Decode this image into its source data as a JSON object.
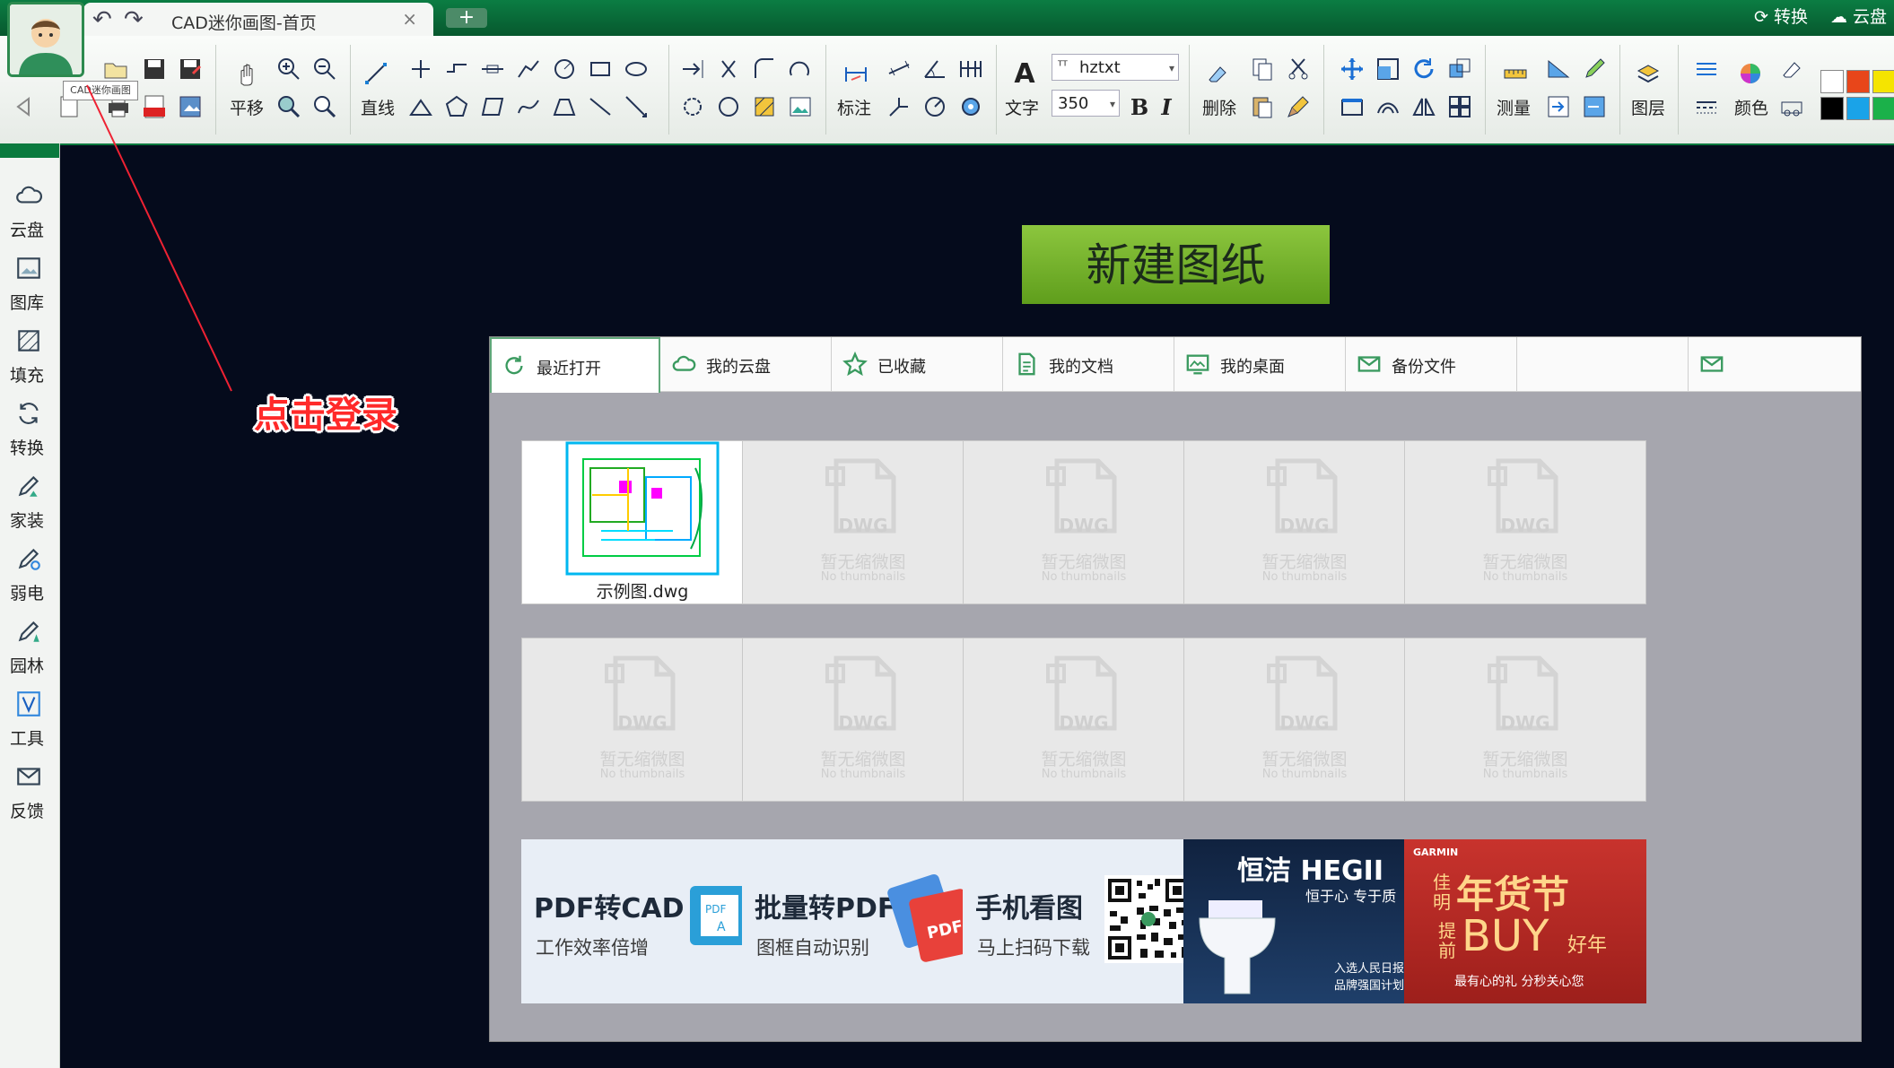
{
  "titlebar": {
    "tab_title": "CAD迷你画图-首页",
    "close_glyph": "×",
    "new_tab_glyph": "+",
    "convert_label": "转换",
    "cloud_label": "云盘"
  },
  "avatar": {
    "tooltip": "CAD迷你画图"
  },
  "toolbar": {
    "pan_label": "平移",
    "line_label": "直线",
    "dimension_label": "标注",
    "text_label": "文字",
    "font_name": "hztxt",
    "font_size": "350",
    "bold": "B",
    "italic": "I",
    "delete_label": "删除",
    "measure_label": "测量",
    "layer_label": "图层",
    "color_label": "颜色",
    "colors": [
      "#ffffff",
      "#e8461a",
      "#f5e400",
      "#000000",
      "#1aa3e8",
      "#1bb14a"
    ]
  },
  "annotation": {
    "text": "点击登录",
    "color": "#ff2a2a"
  },
  "sidebar": {
    "items": [
      {
        "label": "云盘",
        "icon": "cloud-icon"
      },
      {
        "label": "图库",
        "icon": "gallery-icon"
      },
      {
        "label": "填充",
        "icon": "hatch-icon"
      },
      {
        "label": "转换",
        "icon": "convert-icon"
      },
      {
        "label": "家装",
        "icon": "home-decor-icon"
      },
      {
        "label": "弱电",
        "icon": "low-voltage-icon"
      },
      {
        "label": "园林",
        "icon": "garden-icon"
      },
      {
        "label": "工具",
        "icon": "tools-icon"
      },
      {
        "label": "反馈",
        "icon": "feedback-icon"
      }
    ]
  },
  "main": {
    "new_drawing_label": "新建图纸",
    "tabs": [
      {
        "label": "最近打开",
        "icon": "refresh-icon"
      },
      {
        "label": "我的云盘",
        "icon": "cloud-icon"
      },
      {
        "label": "已收藏",
        "icon": "star-icon"
      },
      {
        "label": "我的文档",
        "icon": "document-icon"
      },
      {
        "label": "我的桌面",
        "icon": "desktop-icon"
      },
      {
        "label": "备份文件",
        "icon": "mail-icon"
      },
      {
        "label": "",
        "icon": ""
      },
      {
        "label": "",
        "icon": "mail-icon"
      }
    ],
    "files": {
      "first_name": "示例图.dwg",
      "dwg_text": "DWG",
      "placeholder_cn": "暂无缩微图",
      "placeholder_en": "No thumbnails"
    },
    "promos": [
      {
        "title": "PDF转CAD",
        "subtitle": "工作效率倍增"
      },
      {
        "title": "批量转PDF",
        "subtitle": "图框自动识别"
      },
      {
        "title": "手机看图",
        "subtitle": "马上扫码下载"
      },
      {
        "brand": "恒洁 HEGII",
        "slogan": "恒于心 专于质",
        "line1": "入选人民日报社",
        "line2": "品牌强国计划"
      },
      {
        "brand": "GARMIN",
        "headline": "年货节",
        "left1": "佳",
        "left2": "明",
        "mid1": "提",
        "mid2": "前",
        "big": "BUY",
        "tail": "好年",
        "footer": "最有心的礼 分秒关心您"
      }
    ]
  }
}
